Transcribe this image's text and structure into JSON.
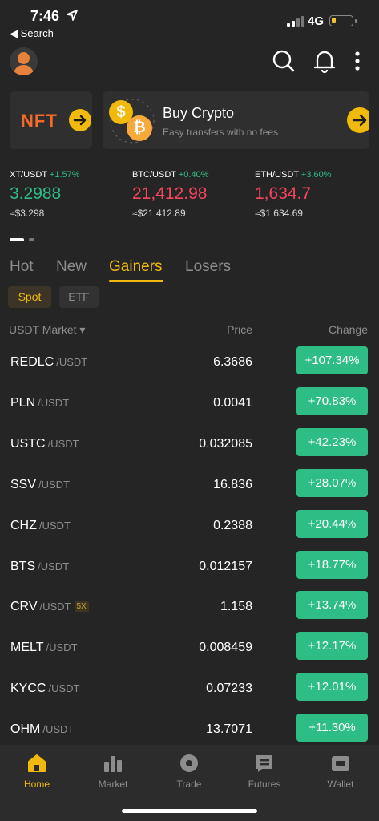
{
  "status_bar": {
    "time": "7:46",
    "back_label": "◀ Search",
    "network": "4G",
    "battery_level": 0.2
  },
  "header": {
    "icons": [
      "profile-avatar",
      "search-icon",
      "bell-icon",
      "more-icon"
    ]
  },
  "banners": {
    "nft": {
      "label": "NFT"
    },
    "buy": {
      "title": "Buy Crypto",
      "subtitle": "Easy transfers with no fees"
    }
  },
  "tickers": [
    {
      "pair": "XT/USDT",
      "change": "+1.57%",
      "price": "3.2988",
      "approx": "≈$3.298",
      "direction": "up"
    },
    {
      "pair": "BTC/USDT",
      "change": "+0.40%",
      "price": "21,412.98",
      "approx": "≈$21,412.89",
      "direction": "down"
    },
    {
      "pair": "ETH/USDT",
      "change": "+3.60%",
      "price": "1,634.7",
      "approx": "≈$1,634.69",
      "direction": "down"
    }
  ],
  "tabs": [
    {
      "label": "Hot",
      "active": false
    },
    {
      "label": "New",
      "active": false
    },
    {
      "label": "Gainers",
      "active": true
    },
    {
      "label": "Losers",
      "active": false
    }
  ],
  "chips": [
    {
      "label": "Spot",
      "active": true
    },
    {
      "label": "ETF",
      "active": false
    }
  ],
  "table": {
    "headers": {
      "market": "USDT Market ▾",
      "price": "Price",
      "change": "Change"
    },
    "rows": [
      {
        "symbol": "REDLC",
        "quote": "/USDT",
        "badge": "",
        "price": "6.3686",
        "change": "+107.34%"
      },
      {
        "symbol": "PLN",
        "quote": "/USDT",
        "badge": "",
        "price": "0.0041",
        "change": "+70.83%"
      },
      {
        "symbol": "USTC",
        "quote": "/USDT",
        "badge": "",
        "price": "0.032085",
        "change": "+42.23%"
      },
      {
        "symbol": "SSV",
        "quote": "/USDT",
        "badge": "",
        "price": "16.836",
        "change": "+28.07%"
      },
      {
        "symbol": "CHZ",
        "quote": "/USDT",
        "badge": "",
        "price": "0.2388",
        "change": "+20.44%"
      },
      {
        "symbol": "BTS",
        "quote": "/USDT",
        "badge": "",
        "price": "0.012157",
        "change": "+18.77%"
      },
      {
        "symbol": "CRV",
        "quote": "/USDT",
        "badge": "5X",
        "price": "1.158",
        "change": "+13.74%"
      },
      {
        "symbol": "MELT",
        "quote": "/USDT",
        "badge": "",
        "price": "0.008459",
        "change": "+12.17%"
      },
      {
        "symbol": "KYCC",
        "quote": "/USDT",
        "badge": "",
        "price": "0.07233",
        "change": "+12.01%"
      },
      {
        "symbol": "OHM",
        "quote": "/USDT",
        "badge": "",
        "price": "13.7071",
        "change": "+11.30%"
      }
    ]
  },
  "bottom_nav": [
    {
      "label": "Home",
      "icon": "home-icon",
      "active": true
    },
    {
      "label": "Market",
      "icon": "market-icon",
      "active": false
    },
    {
      "label": "Trade",
      "icon": "trade-icon",
      "active": false
    },
    {
      "label": "Futures",
      "icon": "futures-icon",
      "active": false
    },
    {
      "label": "Wallet",
      "icon": "wallet-icon",
      "active": false
    }
  ],
  "colors": {
    "accent": "#f0b90b",
    "up": "#2ebd85",
    "down": "#f6465d",
    "background": "#252525"
  }
}
